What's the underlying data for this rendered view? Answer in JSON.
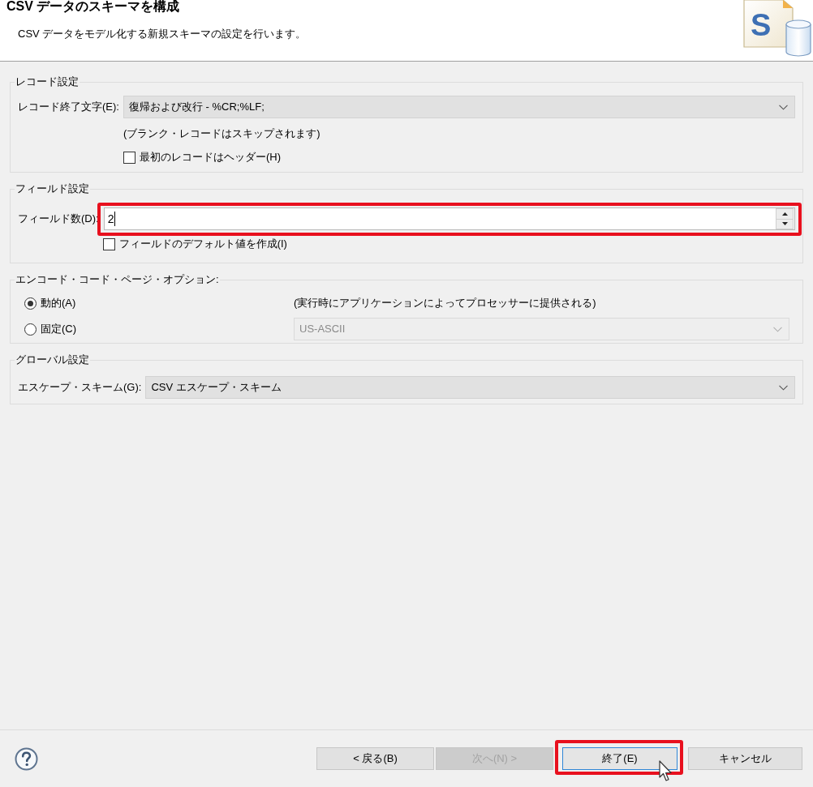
{
  "header": {
    "title": "CSV データのスキーマを構成",
    "description": "CSV データをモデル化する新規スキーマの設定を行います。",
    "icon_letter": "S"
  },
  "record_settings": {
    "legend": "レコード設定",
    "terminator": {
      "label": "レコード終了文字(E):",
      "value": "復帰および改行 - %CR;%LF;"
    },
    "note": "(ブランク・レコードはスキップされます)",
    "header_checkbox": {
      "label": "最初のレコードはヘッダー(H)",
      "checked": false
    }
  },
  "field_settings": {
    "legend": "フィールド設定",
    "field_count": {
      "label": "フィールド数(D):",
      "value": "2",
      "focused": true,
      "highlighted": true
    },
    "default_checkbox": {
      "label": "フィールドのデフォルト値を作成(I)",
      "checked": false
    }
  },
  "encoding_options": {
    "legend": "エンコード・コード・ページ・オプション:",
    "options": [
      {
        "label": "動的(A)",
        "selected": true
      },
      {
        "label": "固定(C)",
        "selected": false
      }
    ],
    "note": "(実行時にアプリケーションによってプロセッサーに提供される)",
    "code_page": {
      "value": "US-ASCII",
      "disabled": true
    }
  },
  "global_settings": {
    "legend": "グローバル設定",
    "escape_scheme": {
      "label": "エスケープ・スキーム(G):",
      "value": "CSV エスケープ・スキーム"
    }
  },
  "buttons": [
    {
      "label": "< 戻る(B)",
      "disabled": false,
      "default": false,
      "highlighted": false,
      "hovered": false
    },
    {
      "label": "次へ(N) >",
      "disabled": true,
      "default": false,
      "highlighted": false,
      "hovered": false
    },
    {
      "label": "終了(E)",
      "disabled": false,
      "default": true,
      "highlighted": true,
      "hovered": true
    },
    {
      "label": "キャンセル",
      "disabled": false,
      "default": false,
      "highlighted": false,
      "hovered": false
    }
  ]
}
